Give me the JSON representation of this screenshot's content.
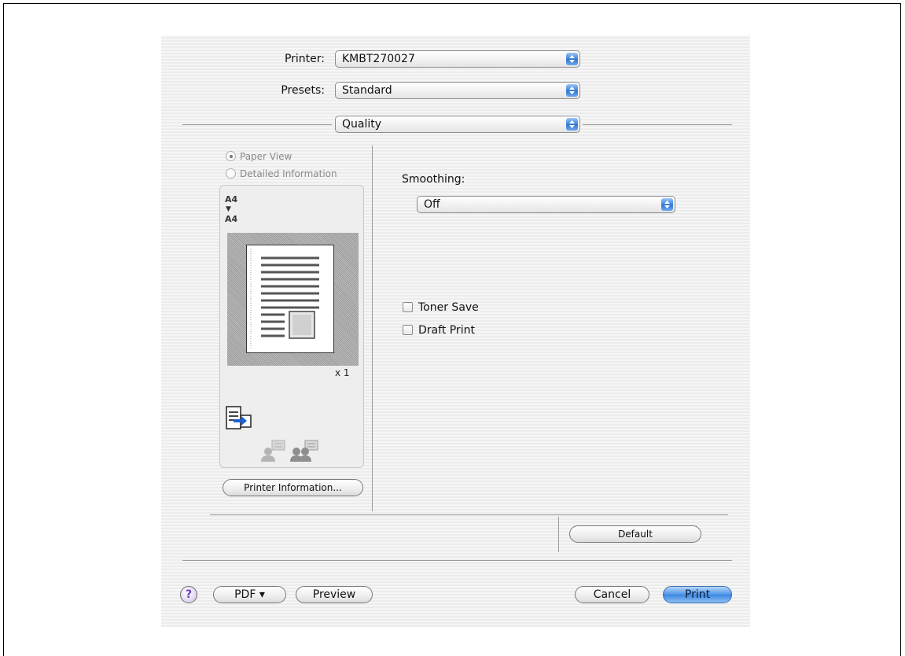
{
  "printer": {
    "label": "Printer:",
    "value": "KMBT270027"
  },
  "presets": {
    "label": "Presets:",
    "value": "Standard"
  },
  "panel": {
    "value": "Quality"
  },
  "view_options": [
    {
      "label": "Paper View",
      "selected": true
    },
    {
      "label": "Detailed Information",
      "selected": false
    }
  ],
  "preview": {
    "source_size": "A4",
    "target_size": "A4",
    "arrow": "▼",
    "copies": "x 1",
    "icons": [
      "printer-output-icon",
      "user-gray-icon",
      "user-group-icon"
    ]
  },
  "printer_info_button": "Printer Information...",
  "smoothing": {
    "label": "Smoothing:",
    "value": "Off"
  },
  "checkboxes": [
    {
      "label": "Toner Save",
      "checked": false
    },
    {
      "label": "Draft Print",
      "checked": false
    }
  ],
  "default_button": "Default",
  "footer": {
    "help": "?",
    "pdf": "PDF ▾",
    "preview": "Preview",
    "cancel": "Cancel",
    "print": "Print"
  },
  "colors": {
    "accent": "#3c86e0",
    "help_glyph": "#6a3fb8"
  }
}
